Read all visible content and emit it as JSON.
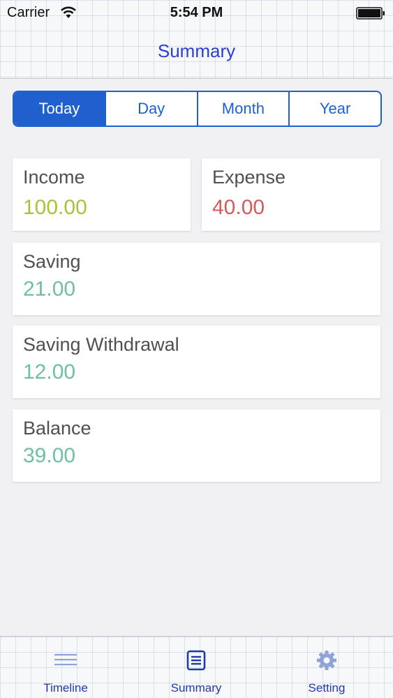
{
  "status_bar": {
    "carrier": "Carrier",
    "time": "5:54 PM"
  },
  "nav": {
    "title": "Summary"
  },
  "segments": {
    "items": [
      "Today",
      "Day",
      "Month",
      "Year"
    ],
    "selected": "Today"
  },
  "cards": {
    "income": {
      "label": "Income",
      "value": "100.00",
      "color": "#a4c43a"
    },
    "expense": {
      "label": "Expense",
      "value": "40.00",
      "color": "#d65a5a"
    },
    "saving": {
      "label": "Saving",
      "value": "21.00",
      "color": "#6fbfa5"
    },
    "saving_withdrawal": {
      "label": "Saving Withdrawal",
      "value": "12.00",
      "color": "#6fbfa5"
    },
    "balance": {
      "label": "Balance",
      "value": "39.00",
      "color": "#6fbfa5"
    }
  },
  "tab_bar": {
    "timeline": {
      "label": "Timeline",
      "icon": "list-lines-icon"
    },
    "summary": {
      "label": "Summary",
      "icon": "document-icon"
    },
    "setting": {
      "label": "Setting",
      "icon": "gear-icon"
    }
  },
  "colors": {
    "accent": "#1f5fce",
    "title": "#2a3ed6"
  }
}
